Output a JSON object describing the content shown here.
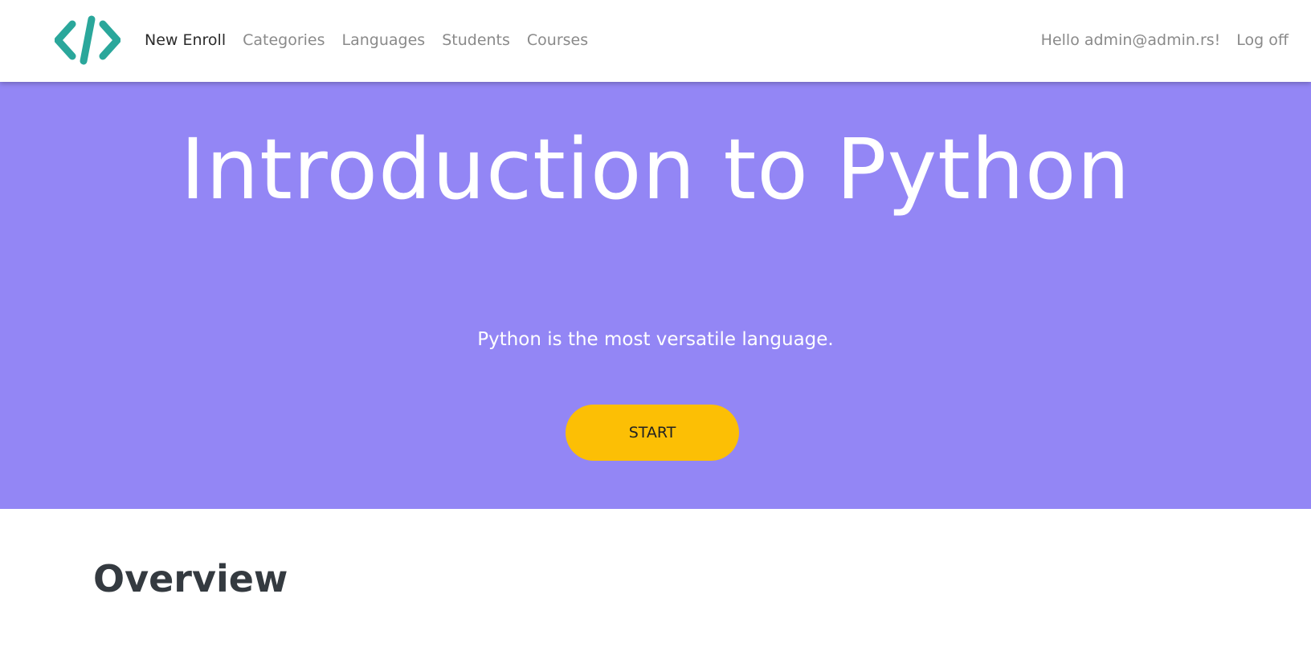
{
  "nav": {
    "logo": "code-brackets-icon",
    "links": [
      {
        "label": "New Enroll",
        "active": true
      },
      {
        "label": "Categories",
        "active": false
      },
      {
        "label": "Languages",
        "active": false
      },
      {
        "label": "Students",
        "active": false
      },
      {
        "label": "Courses",
        "active": false
      }
    ],
    "greeting": "Hello admin@admin.rs!",
    "logoff": "Log off"
  },
  "hero": {
    "title": "Introduction to Python",
    "subtitle": "Python is the most versatile language.",
    "button_label": "START",
    "background_color": "#9386f5",
    "button_color": "#fcbf05"
  },
  "content": {
    "heading": "Overview"
  },
  "colors": {
    "logo_teal": "#2aa79b",
    "nav_text": "#8a8a8a",
    "nav_active_text": "#2b2b2b",
    "heading_text": "#343a40"
  }
}
